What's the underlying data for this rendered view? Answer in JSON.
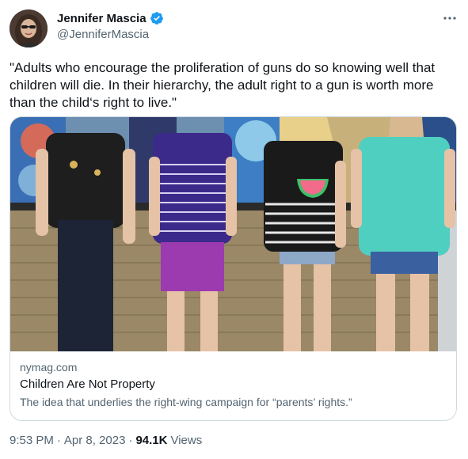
{
  "author": {
    "display_name": "Jennifer Mascia",
    "handle": "@JenniferMascia",
    "verified": true,
    "avatar_icon": "avatar-photo"
  },
  "tweet": {
    "text": "\"Adults who encourage the proliferation of guns do so knowing well that children will die. In their hierarchy, the adult right to a gun is worth more than the child‘s right to live.\""
  },
  "card": {
    "domain": "nymag.com",
    "title": "Children Are Not Property",
    "description": "The idea that underlies the right-wing campaign for “parents’ rights.”"
  },
  "footer": {
    "time": "9:53 PM",
    "separator": "·",
    "date": "Apr 8, 2023",
    "views_count": "94.1K",
    "views_label": "Views"
  },
  "colors": {
    "text_primary": "#0f1419",
    "text_secondary": "#536471",
    "verified_blue": "#1d9bf0",
    "border": "#cfd9de"
  },
  "icons": {
    "verified": "verified-badge-icon",
    "more": "more-options-icon"
  }
}
